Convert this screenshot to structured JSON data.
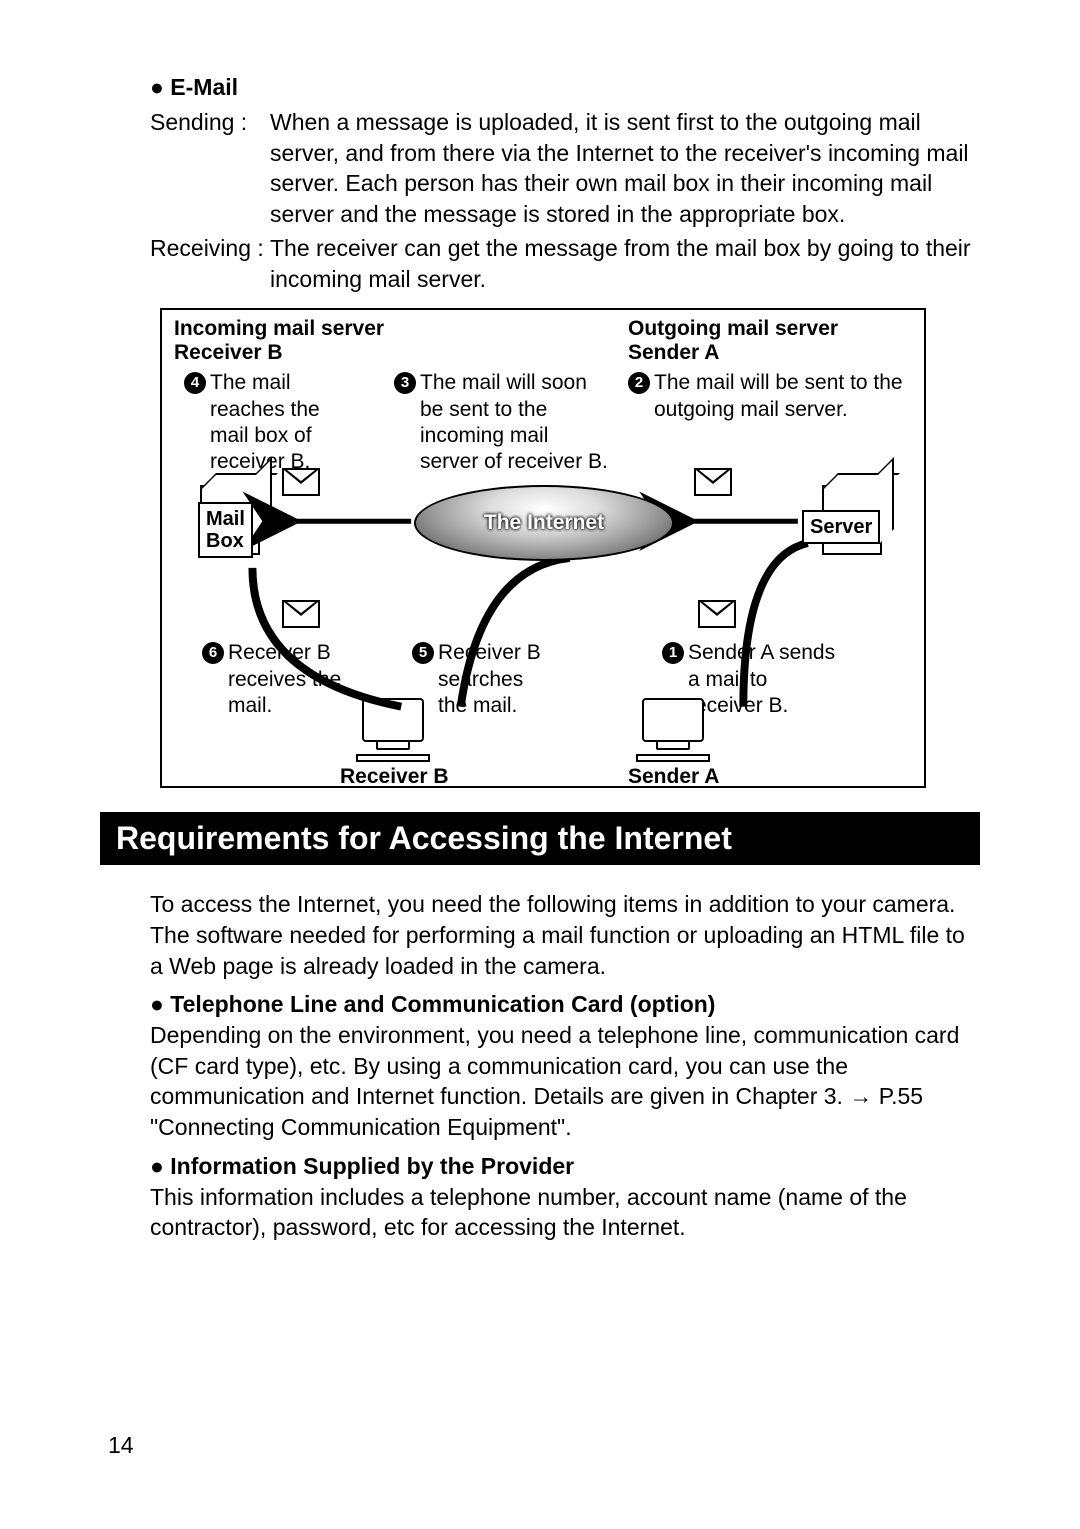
{
  "email": {
    "heading": "E-Mail",
    "sending_term": "Sending :",
    "sending_body": "When a message is uploaded, it is sent first to the outgoing mail server, and from there via the Internet to the receiver's incoming mail server. Each person has their own mail box in their incoming mail server and the message is stored in the appropriate box.",
    "receiving_term": "Receiving :",
    "receiving_body": "The receiver can get the message from the mail box by going to their incoming mail server."
  },
  "diagram": {
    "incoming_label": "Incoming mail server",
    "receiver_b_top": "Receiver B",
    "outgoing_label": "Outgoing mail server",
    "sender_a_top": "Sender A",
    "step1": "Sender A sends a mail to receiver B.",
    "step2": "The mail will be sent to the outgoing mail server.",
    "step3": "The mail will soon be sent to the incoming mail server of receiver B.",
    "step4": "The mail reaches the mail box of receiver B.",
    "step5": "Receiver B searches the mail.",
    "step6": "Receiver B receives the mail.",
    "mail_box": "Mail\nBox",
    "internet": "The Internet",
    "server": "Server",
    "receiver_b_bottom": "Receiver B",
    "sender_a_bottom": "Sender A"
  },
  "section_title": "Requirements for Accessing the Internet",
  "req": {
    "intro": "To access the Internet, you need the following items in addition to your camera. The software needed for performing a mail function or uploading an HTML file to a Web page is already loaded in the camera.",
    "tel_head": "Telephone Line and Communication Card (option)",
    "tel_body": "Depending on the environment, you need a telephone line, communication card (CF card type), etc. By using a communication card, you can use the communication and Internet function. Details are given in Chapter 3. → P.55 \"Connecting Communication Equipment\".",
    "info_head": "Information Supplied by the Provider",
    "info_body": "This information includes a telephone number, account name (name of the contractor), password, etc for accessing the Internet."
  },
  "page_number": "14"
}
